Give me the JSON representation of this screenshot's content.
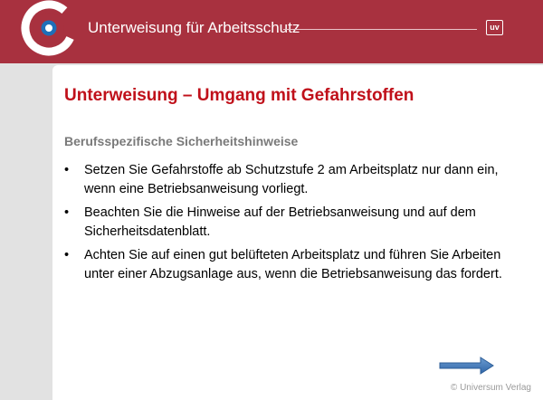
{
  "header": {
    "title": "Unterweisung für Arbeitsschutz",
    "badge": "uv",
    "background_color": "#a8313f"
  },
  "slide": {
    "title": "Unterweisung – Umgang mit Gefahrstoffen",
    "subtitle": "Berufsspezifische Sicherheitshinweise",
    "bullets": [
      "Setzen Sie Gefahrstoffe ab Schutzstufe 2 am Arbeitsplatz nur dann ein, wenn eine Betriebsanweisung vorliegt.",
      "Beachten Sie die Hinweise auf der Betriebsanweisung und auf dem Sicherheitsdatenblatt.",
      "Achten Sie auf einen gut belüfteten Arbeitsplatz und führen Sie Arbeiten unter einer Abzugsanlage aus, wenn die Betriebsanweisung das fordert."
    ],
    "bullet_marker": "•",
    "title_color": "#c0101a"
  },
  "navigation": {
    "next_icon": "arrow-right-icon"
  },
  "footer": {
    "copyright": "© Universum Verlag"
  }
}
